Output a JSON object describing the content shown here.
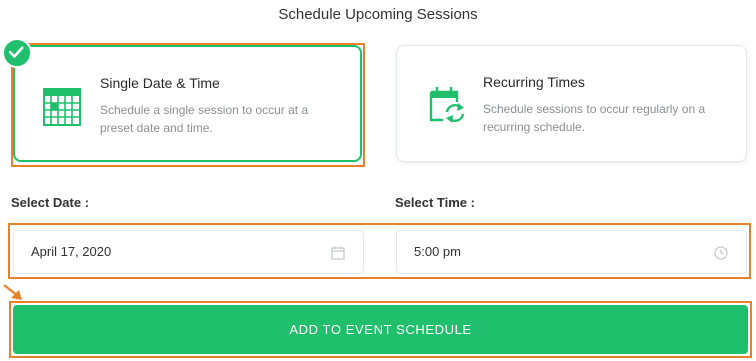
{
  "page": {
    "title": "Schedule Upcoming Sessions"
  },
  "options": [
    {
      "title": "Single Date & Time",
      "description": "Schedule a single session to occur at a preset date and time.",
      "icon": "calendar-icon",
      "selected": true
    },
    {
      "title": "Recurring Times",
      "description": "Schedule sessions to occur regularly on a recurring schedule.",
      "icon": "recurring-calendar-icon",
      "selected": false
    }
  ],
  "date_field": {
    "label": "Select Date :",
    "value": "April 17, 2020",
    "icon": "calendar-icon"
  },
  "time_field": {
    "label": "Select Time :",
    "value": "5:00 pm",
    "icon": "clock-icon"
  },
  "submit_label": "ADD TO EVENT SCHEDULE",
  "colors": {
    "accent": "#1fbf6b",
    "highlight": "#e8822a"
  }
}
